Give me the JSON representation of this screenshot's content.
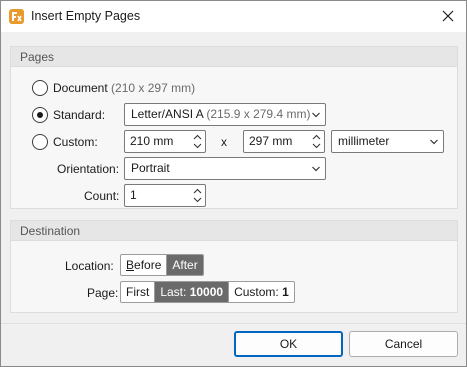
{
  "window": {
    "title": "Insert Empty Pages"
  },
  "pages_group": {
    "header": "Pages",
    "document": {
      "label": "Document",
      "size": "(210 x 297 mm)"
    },
    "standard": {
      "label": "Standard:",
      "select_value": "Letter/ANSI A",
      "select_size": "(215.9 x 279.4 mm)"
    },
    "custom": {
      "label": "Custom:",
      "width": "210 mm",
      "x_sep": "x",
      "height": "297 mm",
      "unit": "millimeter"
    },
    "orientation": {
      "label": "Orientation:",
      "value": "Portrait"
    },
    "count": {
      "label": "Count:",
      "value": "1"
    }
  },
  "destination_group": {
    "header": "Destination",
    "location": {
      "label": "Location:",
      "before": "Before",
      "after": "After"
    },
    "page": {
      "label": "Page:",
      "first": "First",
      "last_label": "Last:",
      "last_value": "10000",
      "custom_label": "Custom:",
      "custom_value": "1"
    }
  },
  "buttons": {
    "ok": "OK",
    "cancel": "Cancel"
  },
  "colors": {
    "accent": "#0067c0",
    "app_icon": "#e89a2c",
    "selected_segment": "#6a6a6a"
  }
}
